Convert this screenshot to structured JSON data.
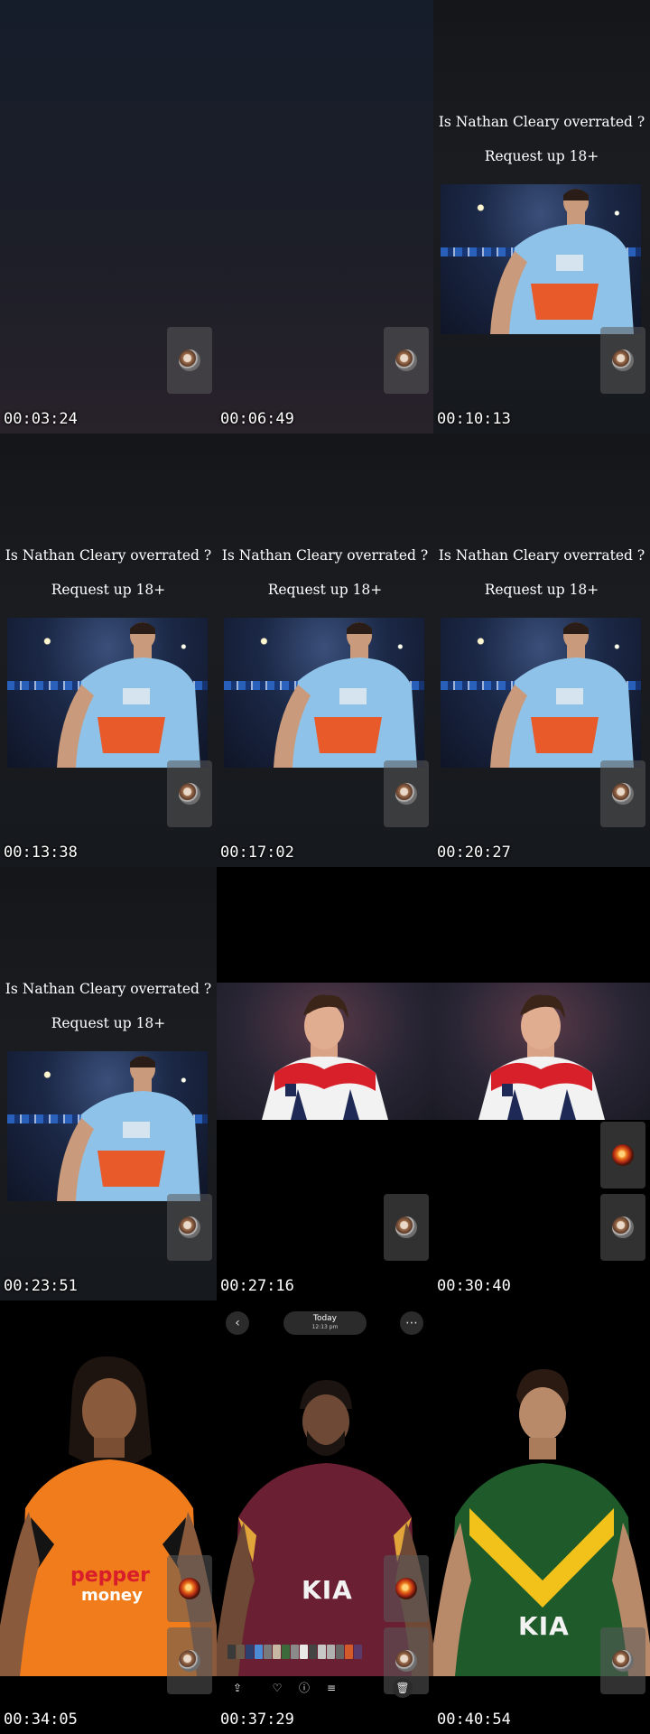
{
  "question_text": "Is Nathan Cleary overrated ?",
  "request_text": "Request up 18+",
  "timestamps": [
    "00:03:24",
    "00:06:49",
    "00:10:13",
    "00:13:38",
    "00:17:02",
    "00:20:27",
    "00:23:51",
    "00:27:16",
    "00:30:40",
    "00:34:05",
    "00:37:29",
    "00:40:54"
  ],
  "gallery_ui": {
    "date_title": "Today",
    "date_time": "12:13 pm",
    "back_icon": "chevron-left-icon",
    "more_icon": "more-horizontal-icon",
    "actions": [
      "share-icon",
      "heart-icon",
      "info-icon",
      "adjust-icon",
      "trash-icon"
    ]
  },
  "colors": {
    "text": "#ffffff",
    "background": "#000000"
  }
}
